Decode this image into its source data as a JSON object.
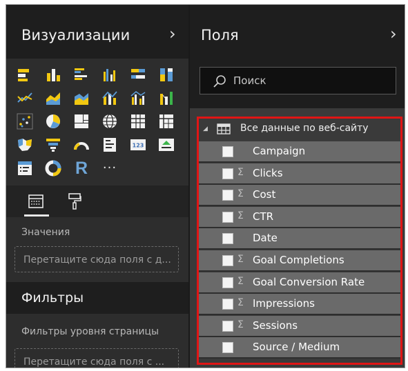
{
  "visualizations": {
    "title": "Визуализации",
    "chevron": "›",
    "icons": [
      "stacked-bar-chart-icon",
      "stacked-column-chart-icon",
      "clustered-bar-chart-icon",
      "clustered-column-chart-icon",
      "100pct-stacked-bar-chart-icon",
      "100pct-stacked-column-chart-icon",
      "line-chart-icon",
      "area-chart-icon",
      "stacked-area-chart-icon",
      "line-and-stacked-column-chart-icon",
      "line-and-clustered-column-chart-icon",
      "ribbon-chart-icon",
      "scatter-chart-icon",
      "pie-chart-icon",
      "treemap-icon",
      "map-icon",
      "table-icon",
      "matrix-icon",
      "filled-map-icon",
      "funnel-icon",
      "gauge-icon",
      "multi-row-card-icon",
      "card-icon",
      "kpi-icon",
      "slicer-icon",
      "donut-chart-icon",
      "r-script-visual-icon",
      "more-visuals-icon"
    ],
    "r_label": "R",
    "more_label": "···",
    "values_label": "Значения",
    "values_drop_placeholder": "Перетащите сюда поля с д..."
  },
  "filters": {
    "title": "Фильтры",
    "page_level_label": "Фильтры уровня страницы",
    "page_level_drop_placeholder": "Перетащите сюда поля с ..."
  },
  "fields_pane": {
    "title": "Поля",
    "chevron": "›",
    "search_placeholder": "Поиск",
    "table": {
      "expand_glyph": "◢",
      "name": "Все данные по веб-сайту",
      "fields": [
        {
          "name": "Campaign",
          "sigma": ""
        },
        {
          "name": "Clicks",
          "sigma": "Σ"
        },
        {
          "name": "Cost",
          "sigma": "Σ"
        },
        {
          "name": "CTR",
          "sigma": "Σ"
        },
        {
          "name": "Date",
          "sigma": ""
        },
        {
          "name": "Goal Completions",
          "sigma": "Σ"
        },
        {
          "name": "Goal Conversion Rate",
          "sigma": "Σ"
        },
        {
          "name": "Impressions",
          "sigma": "Σ"
        },
        {
          "name": "Sessions",
          "sigma": "Σ"
        },
        {
          "name": "Source / Medium",
          "sigma": ""
        }
      ]
    }
  },
  "colors": {
    "highlight_border": "#e01515",
    "pane_header_bg": "#1e1e1e",
    "pane_bg": "#2d2d2d",
    "field_row_bg": "#6a6a6a",
    "viz_yellow": "#f2c811",
    "viz_blue": "#5b9bd5",
    "viz_green": "#3bb44a"
  }
}
